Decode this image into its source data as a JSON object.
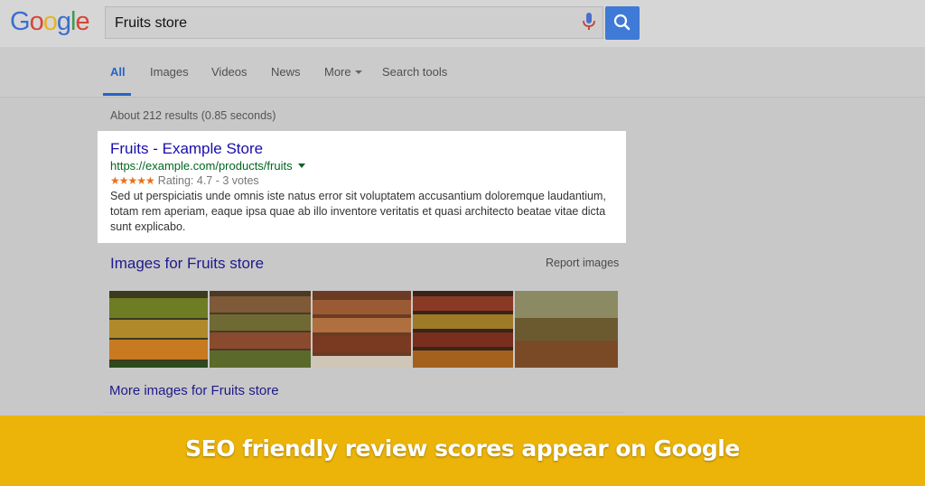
{
  "logo": {
    "letters": [
      "G",
      "o",
      "o",
      "g",
      "l",
      "e"
    ],
    "colors": [
      "#3a6fd0",
      "#d64537",
      "#e7b325",
      "#3a6fd0",
      "#3f9a50",
      "#d64537"
    ]
  },
  "search": {
    "value": "Fruits store",
    "mic_icon": "microphone-icon",
    "button_icon": "magnifier-icon"
  },
  "tabs": [
    {
      "label": "All",
      "active": true
    },
    {
      "label": "Images"
    },
    {
      "label": "Videos"
    },
    {
      "label": "News"
    },
    {
      "label": "More",
      "has_caret": true
    },
    {
      "label": "Search tools"
    }
  ],
  "result_stats": "About 212 results (0.85 seconds)",
  "result": {
    "title": "Fruits - Example Store",
    "url": "https://example.com/products/fruits",
    "stars": "★★★★★",
    "rating_text": "Rating: 4.7 - 3 votes",
    "snippet": "Sed ut perspiciatis unde omnis iste natus error sit voluptatem accusantium doloremque laudantium, totam rem aperiam, eaque ipsa quae ab illo inventore veritatis et quasi architecto beatae vitae dicta sunt explicabo."
  },
  "images_section": {
    "heading": "Images for Fruits store",
    "report_label": "Report images",
    "more_label": "More images for Fruits store"
  },
  "banner": {
    "text": "SEO friendly review scores appear on Google",
    "color": "#ecb409"
  },
  "colors": {
    "link": "#1a0dab",
    "url_green": "#006621",
    "accent_blue": "#3f7ad6",
    "star_orange": "#e7711b"
  }
}
